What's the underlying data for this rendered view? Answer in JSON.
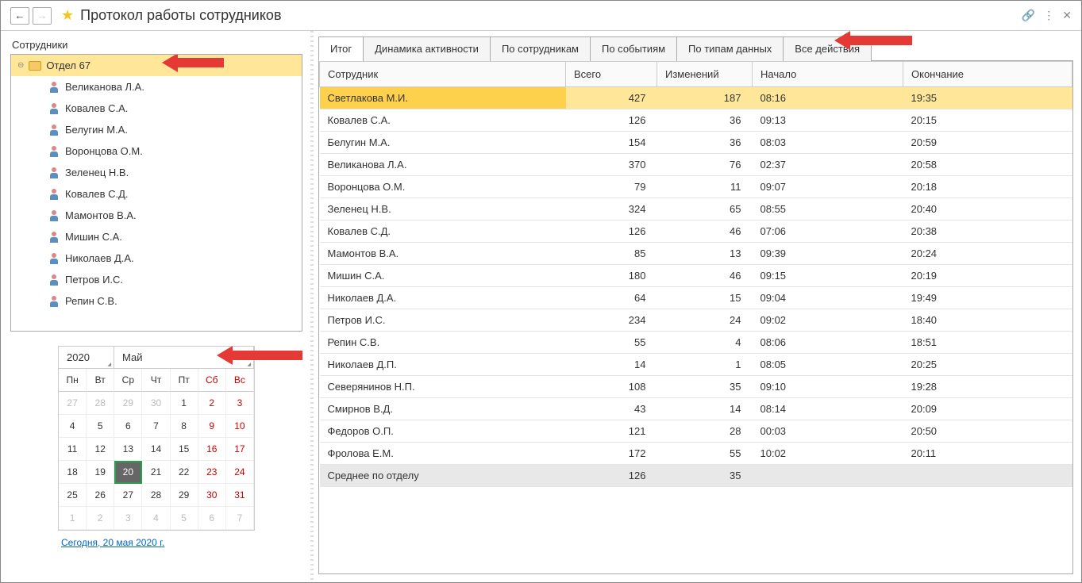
{
  "header": {
    "title": "Протокол работы сотрудников"
  },
  "sidebar": {
    "label": "Сотрудники",
    "folder": "Отдел 67",
    "employees": [
      "Великанова Л.А.",
      "Ковалев С.А.",
      "Белугин М.А.",
      "Воронцова О.М.",
      "Зеленец Н.В.",
      "Ковалев С.Д.",
      "Мамонтов В.А.",
      "Мишин С.А.",
      "Николаев Д.А.",
      "Петров И.С.",
      "Репин С.В."
    ]
  },
  "calendar": {
    "year": "2020",
    "month": "Май",
    "weekdays": [
      "Пн",
      "Вт",
      "Ср",
      "Чт",
      "Пт",
      "Сб",
      "Вс"
    ],
    "today_link": "Сегодня, 20 мая 2020 г.",
    "days": [
      {
        "n": "27",
        "cls": "other"
      },
      {
        "n": "28",
        "cls": "other"
      },
      {
        "n": "29",
        "cls": "other"
      },
      {
        "n": "30",
        "cls": "other"
      },
      {
        "n": "1",
        "cls": ""
      },
      {
        "n": "2",
        "cls": "wkend"
      },
      {
        "n": "3",
        "cls": "wkend"
      },
      {
        "n": "4",
        "cls": ""
      },
      {
        "n": "5",
        "cls": ""
      },
      {
        "n": "6",
        "cls": ""
      },
      {
        "n": "7",
        "cls": ""
      },
      {
        "n": "8",
        "cls": ""
      },
      {
        "n": "9",
        "cls": "wkend"
      },
      {
        "n": "10",
        "cls": "wkend"
      },
      {
        "n": "11",
        "cls": ""
      },
      {
        "n": "12",
        "cls": ""
      },
      {
        "n": "13",
        "cls": ""
      },
      {
        "n": "14",
        "cls": ""
      },
      {
        "n": "15",
        "cls": ""
      },
      {
        "n": "16",
        "cls": "wkend"
      },
      {
        "n": "17",
        "cls": "wkend"
      },
      {
        "n": "18",
        "cls": ""
      },
      {
        "n": "19",
        "cls": ""
      },
      {
        "n": "20",
        "cls": "selected"
      },
      {
        "n": "21",
        "cls": ""
      },
      {
        "n": "22",
        "cls": ""
      },
      {
        "n": "23",
        "cls": "wkend"
      },
      {
        "n": "24",
        "cls": "wkend"
      },
      {
        "n": "25",
        "cls": ""
      },
      {
        "n": "26",
        "cls": ""
      },
      {
        "n": "27",
        "cls": ""
      },
      {
        "n": "28",
        "cls": ""
      },
      {
        "n": "29",
        "cls": ""
      },
      {
        "n": "30",
        "cls": "wkend"
      },
      {
        "n": "31",
        "cls": "wkend"
      },
      {
        "n": "1",
        "cls": "other"
      },
      {
        "n": "2",
        "cls": "other"
      },
      {
        "n": "3",
        "cls": "other"
      },
      {
        "n": "4",
        "cls": "other"
      },
      {
        "n": "5",
        "cls": "other"
      },
      {
        "n": "6",
        "cls": "other"
      },
      {
        "n": "7",
        "cls": "other"
      }
    ]
  },
  "tabs": [
    "Итог",
    "Динамика активности",
    "По сотрудникам",
    "По событиям",
    "По типам данных",
    "Все действия"
  ],
  "table": {
    "columns": [
      "Сотрудник",
      "Всего",
      "Изменений",
      "Начало",
      "Окончание"
    ],
    "rows": [
      {
        "name": "Светлакова М.И.",
        "total": "427",
        "chg": "187",
        "start": "08:16",
        "end": "19:35",
        "sel": true
      },
      {
        "name": "Ковалев С.А.",
        "total": "126",
        "chg": "36",
        "start": "09:13",
        "end": "20:15"
      },
      {
        "name": "Белугин М.А.",
        "total": "154",
        "chg": "36",
        "start": "08:03",
        "end": "20:59"
      },
      {
        "name": "Великанова Л.А.",
        "total": "370",
        "chg": "76",
        "start": "02:37",
        "end": "20:58"
      },
      {
        "name": "Воронцова О.М.",
        "total": "79",
        "chg": "11",
        "start": "09:07",
        "end": "20:18"
      },
      {
        "name": "Зеленец Н.В.",
        "total": "324",
        "chg": "65",
        "start": "08:55",
        "end": "20:40"
      },
      {
        "name": "Ковалев С.Д.",
        "total": "126",
        "chg": "46",
        "start": "07:06",
        "end": "20:38"
      },
      {
        "name": "Мамонтов В.А.",
        "total": "85",
        "chg": "13",
        "start": "09:39",
        "end": "20:24"
      },
      {
        "name": "Мишин С.А.",
        "total": "180",
        "chg": "46",
        "start": "09:15",
        "end": "20:19"
      },
      {
        "name": "Николаев Д.А.",
        "total": "64",
        "chg": "15",
        "start": "09:04",
        "end": "19:49"
      },
      {
        "name": "Петров И.С.",
        "total": "234",
        "chg": "24",
        "start": "09:02",
        "end": "18:40"
      },
      {
        "name": "Репин С.В.",
        "total": "55",
        "chg": "4",
        "start": "08:06",
        "end": "18:51"
      },
      {
        "name": "Николаев Д.П.",
        "total": "14",
        "chg": "1",
        "start": "08:05",
        "end": "20:25"
      },
      {
        "name": "Северянинов Н.П.",
        "total": "108",
        "chg": "35",
        "start": "09:10",
        "end": "19:28"
      },
      {
        "name": "Смирнов В.Д.",
        "total": "43",
        "chg": "14",
        "start": "08:14",
        "end": "20:09"
      },
      {
        "name": "Федоров О.П.",
        "total": "121",
        "chg": "28",
        "start": "00:03",
        "end": "20:50"
      },
      {
        "name": "Фролова Е.М.",
        "total": "172",
        "chg": "55",
        "start": "10:02",
        "end": "20:11"
      }
    ],
    "summary": {
      "name": "Среднее по отделу",
      "total": "126",
      "chg": "35",
      "start": "",
      "end": ""
    }
  }
}
